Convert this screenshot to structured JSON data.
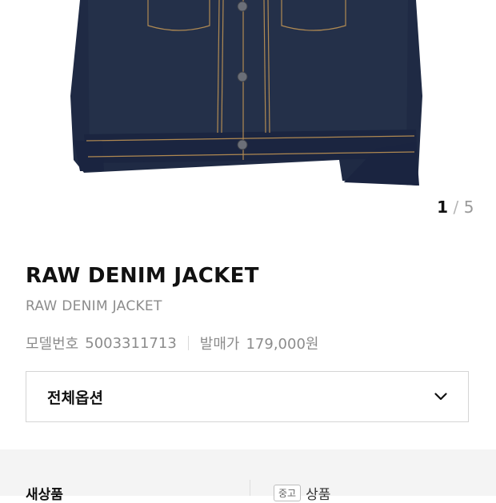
{
  "gallery": {
    "image_alt": "dark raw denim jacket",
    "pager": {
      "current": "1",
      "separator": "/",
      "total": "5"
    }
  },
  "product": {
    "title": "RAW DENIM JACKET",
    "subtitle": "RAW DENIM JACKET",
    "model_label": "모델번호",
    "model_number": "5003311713",
    "price_label": "발매가",
    "release_price": "179,000원"
  },
  "options": {
    "label": "전체옵션",
    "icon": "chevron-down-icon"
  },
  "condition": {
    "left_label": "새상품",
    "badge": "중고",
    "right_label": "상품"
  },
  "colors": {
    "denim": "#1f2a44",
    "stitch": "#c99a55",
    "band": "#f4f4f4"
  }
}
